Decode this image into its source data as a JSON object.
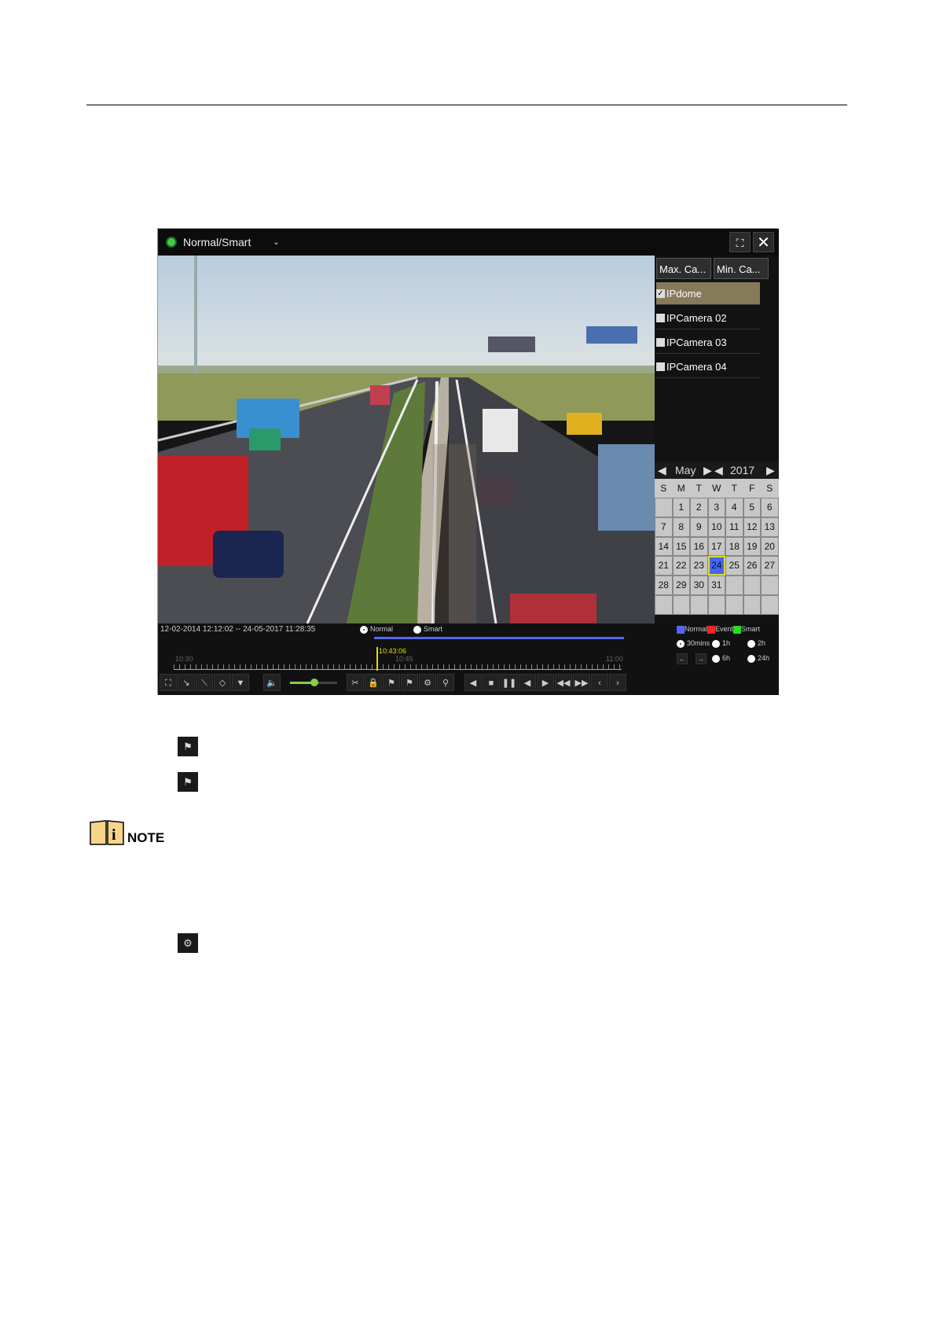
{
  "player": {
    "mode_label": "Normal/Smart",
    "max_camera_label": "Max. Ca...",
    "min_camera_label": "Min. Ca...",
    "cameras": [
      {
        "name": "IPdome",
        "checked": true
      },
      {
        "name": "IPCamera 02",
        "checked": false
      },
      {
        "name": "IPCamera 03",
        "checked": false
      },
      {
        "name": "IPCamera 04",
        "checked": false
      }
    ],
    "calendar": {
      "month": "May",
      "year": "2017",
      "weekdays": [
        "S",
        "M",
        "T",
        "W",
        "T",
        "F",
        "S"
      ],
      "days": [
        "",
        "1",
        "2",
        "3",
        "4",
        "5",
        "6",
        "7",
        "8",
        "9",
        "10",
        "11",
        "12",
        "13",
        "14",
        "15",
        "16",
        "17",
        "18",
        "19",
        "20",
        "21",
        "22",
        "23",
        "24",
        "25",
        "26",
        "27",
        "28",
        "29",
        "30",
        "31",
        "",
        "",
        "",
        "",
        "",
        "",
        "",
        "",
        "",
        ""
      ],
      "selected_day": "24"
    },
    "time_range": "12-02-2014 12:12:02 -- 24-05-2017 11:28:35",
    "playback_modes": {
      "normal": "Normal",
      "smart": "Smart",
      "selected": "Normal"
    },
    "legend": [
      {
        "label": "Normal",
        "color": "#5566ff"
      },
      {
        "label": "Event",
        "color": "#ff2222"
      },
      {
        "label": "Smart",
        "color": "#22dd22"
      }
    ],
    "current_time": "10:43:06",
    "timeline_ticks": [
      "10:30",
      "10:45",
      "11:00"
    ],
    "scales": {
      "options": [
        "30mins",
        "1h",
        "2h",
        "6h",
        "24h"
      ],
      "selected": "30mins"
    },
    "volume_level": 0.5
  },
  "document": {
    "note_label": "NOTE"
  }
}
